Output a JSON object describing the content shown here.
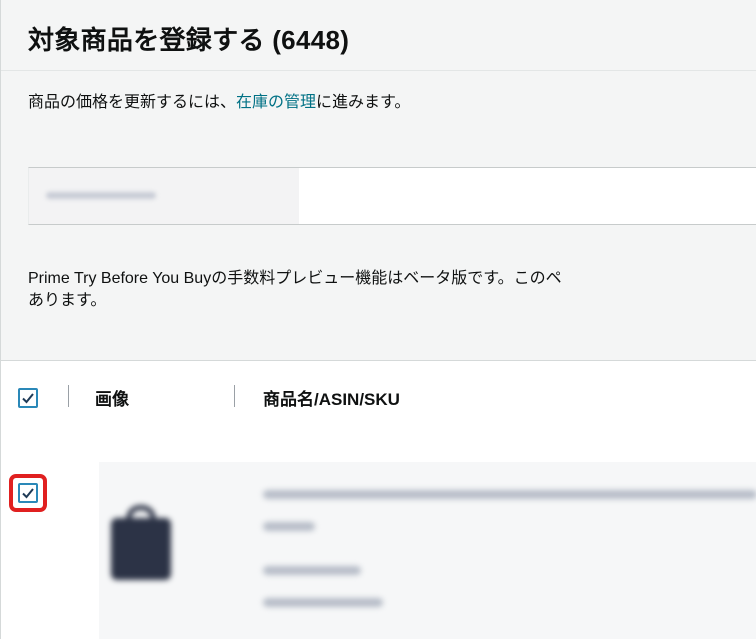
{
  "header": {
    "title": "対象商品を登録する (6448)",
    "subtitle_before": "商品の価格を更新するには、",
    "subtitle_link": "在庫の管理",
    "subtitle_after": "に進みます。",
    "notice_line1": "Prime Try Before You Buyの手数料プレビュー機能はベータ版です。このペ",
    "notice_line2": "あります。"
  },
  "table": {
    "columns": [
      {
        "label": "画像"
      },
      {
        "label": "商品名/ASIN/SKU"
      }
    ],
    "select_all_checked": true
  },
  "rows": [
    {
      "checked": true,
      "highlighted": true
    }
  ],
  "colors": {
    "accent": "#2a88b8",
    "link": "#007185",
    "highlight": "#e02020"
  },
  "icons": {
    "checkbox": "checkmark-icon"
  }
}
